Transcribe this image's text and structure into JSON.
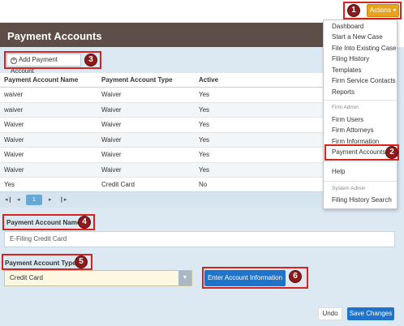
{
  "actions_button": "Actions ▾",
  "panel": {
    "title": "Payment Accounts"
  },
  "add_button": {
    "icon": "plus-circle-icon",
    "label": "Add Payment Account"
  },
  "table": {
    "headers": [
      "Payment Account Name",
      "Payment Account Type",
      "Active"
    ],
    "rows": [
      [
        "waiver",
        "Waiver",
        "Yes"
      ],
      [
        "waiver",
        "Waiver",
        "Yes"
      ],
      [
        "Waiver",
        "Waiver",
        "Yes"
      ],
      [
        "Waiver",
        "Waiver",
        "Yes"
      ],
      [
        "Waiver",
        "Waiver",
        "Yes"
      ],
      [
        "Waiver",
        "Waiver",
        "Yes"
      ],
      [
        "Yes",
        "Credit Card",
        "No"
      ]
    ]
  },
  "pager": {
    "first": "◂❙",
    "prev": "◂",
    "current": "1",
    "next": "▸",
    "last": "❙▸"
  },
  "form": {
    "name_label": "Payment Account Name",
    "name_value": "E-Filing Credit Card",
    "type_label": "Payment Account Type",
    "type_value": "Credit Card",
    "enter_button": "Enter Account Information"
  },
  "footer": {
    "undo": "Undo",
    "save": "Save Changes"
  },
  "menu": {
    "items_top": [
      "Dashboard",
      "Start a New Case",
      "File Into Existing Case",
      "Filing History",
      "Templates",
      "Firm Service Contacts",
      "Reports"
    ],
    "firm_admin_header": "Firm Admin",
    "items_firm": [
      "Firm Users",
      "Firm Attorneys",
      "Firm Information",
      "Payment Accounts"
    ],
    "help": "Help",
    "system_admin_header": "System Admin",
    "items_system": [
      "Filing History Search"
    ]
  },
  "markers": [
    "1",
    "2",
    "3",
    "4",
    "5",
    "6"
  ],
  "colors": {
    "accent_orange": "#e8a31c",
    "header_brown": "#5e4e48",
    "primary_blue": "#1f74c9",
    "marker_red": "#8b1a1a"
  }
}
